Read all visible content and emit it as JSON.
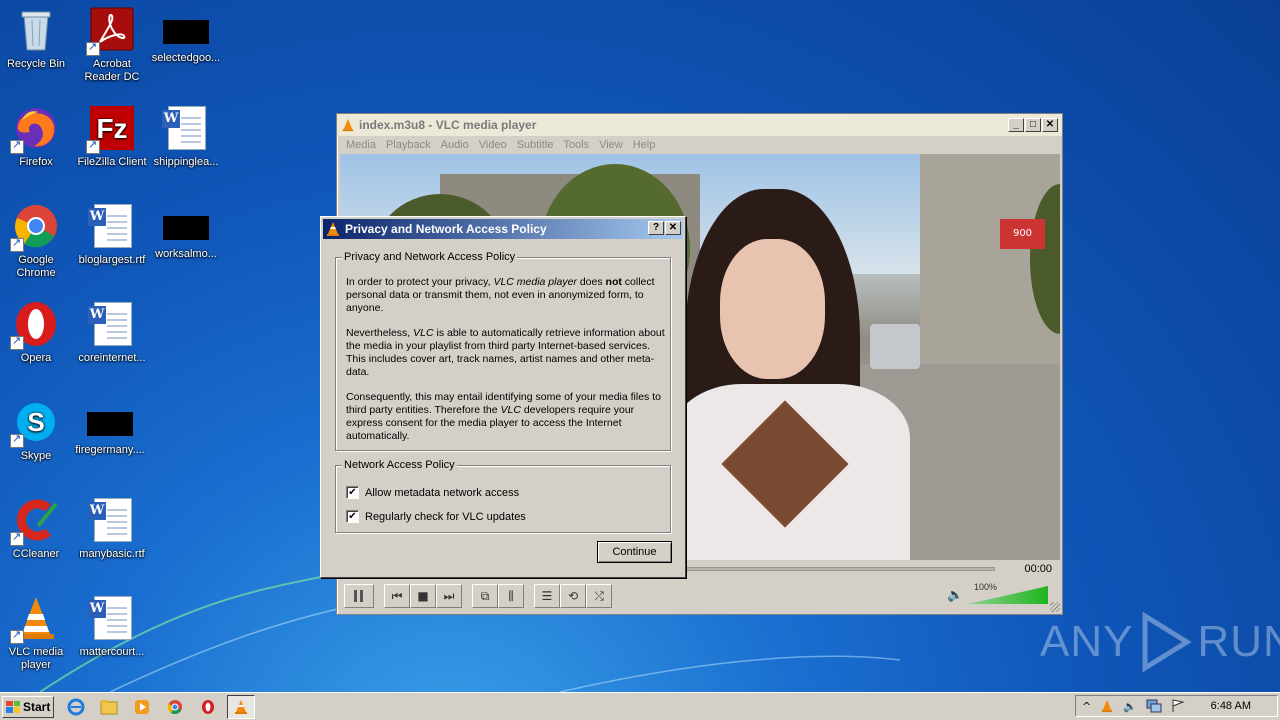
{
  "desktop": {
    "icons": [
      {
        "label": "Recycle Bin"
      },
      {
        "label": "Acrobat Reader DC"
      },
      {
        "label": "selectedgoo..."
      },
      {
        "label": "Firefox"
      },
      {
        "label": "FileZilla Client"
      },
      {
        "label": "shippinglea..."
      },
      {
        "label": "Google Chrome"
      },
      {
        "label": "bloglargest.rtf"
      },
      {
        "label": "worksalmo..."
      },
      {
        "label": "Opera"
      },
      {
        "label": "coreinternet..."
      },
      {
        "label": "Skype"
      },
      {
        "label": "firegermany...."
      },
      {
        "label": "CCleaner"
      },
      {
        "label": "manybasic.rtf"
      },
      {
        "label": "VLC media player"
      },
      {
        "label": "mattercourt..."
      }
    ]
  },
  "vlc": {
    "title": "index.m3u8 - VLC media player",
    "menu": [
      "Media",
      "Playback",
      "Audio",
      "Video",
      "Subtitle",
      "Tools",
      "View",
      "Help"
    ],
    "time": "00:00",
    "volume": "100%",
    "volume_level": 1.0,
    "video_sign": "900"
  },
  "dialog": {
    "title": "Privacy and Network Access Policy",
    "help_btn": "?",
    "close_btn": "✕",
    "group1_title": "Privacy and Network Access Policy",
    "p1_a": "In order to protect your privacy, ",
    "p1_em": "VLC media player",
    "p1_b": " does ",
    "p1_strong": "not",
    "p1_c": " collect personal data or transmit them, not even in anonymized form, to anyone.",
    "p2_a": "Nevertheless, ",
    "p2_em": "VLC",
    "p2_b": " is able to automatically retrieve information about the media in your playlist from third party Internet-based services. This includes cover art, track names, artist names and other meta-data.",
    "p3_a": "Consequently, this may entail identifying some of your media files to third party entities. Therefore the ",
    "p3_em": "VLC",
    "p3_b": " developers require your express consent for the media player to access the Internet automatically.",
    "group2_title": "Network Access Policy",
    "check1": "Allow metadata network access",
    "check2": "Regularly check for VLC updates",
    "check_mark": "✔",
    "continue": "Continue"
  },
  "taskbar": {
    "start": "Start",
    "clock": "6:48 AM",
    "tray_up": "^"
  },
  "watermark": {
    "left": "ANY",
    "right": "RUN"
  }
}
